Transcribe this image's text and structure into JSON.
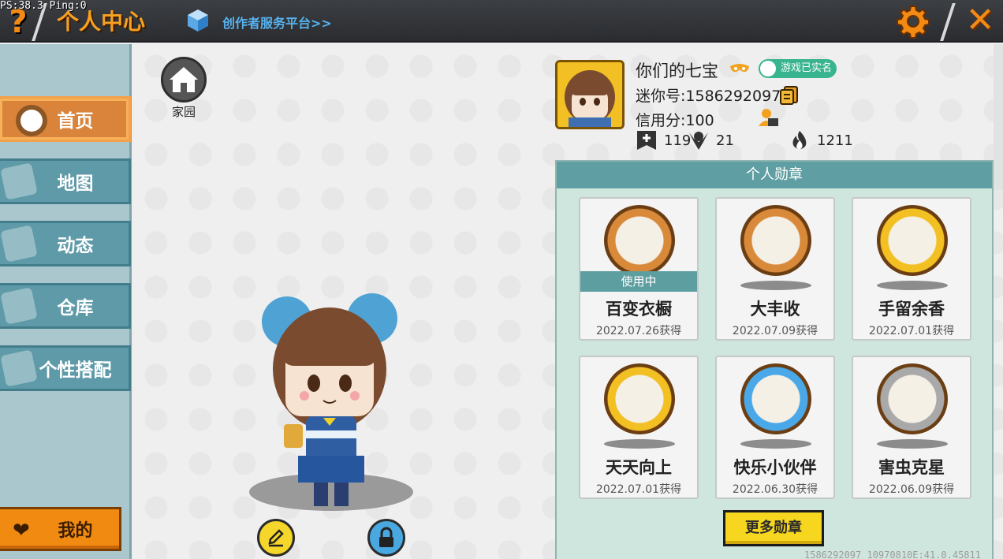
{
  "hud": {
    "fps_text": "PS:38.3  Ping:0"
  },
  "header": {
    "help_glyph": "?",
    "title": "个人中心",
    "creator_link": "创作者服务平台>>",
    "close_glyph": "✕"
  },
  "sidebar": {
    "items": [
      {
        "label": "首页",
        "active": true
      },
      {
        "label": "地图",
        "active": false
      },
      {
        "label": "动态",
        "active": false
      },
      {
        "label": "仓库",
        "active": false
      },
      {
        "label": "个性搭配",
        "active": false
      }
    ],
    "mine_label": "我的"
  },
  "home": {
    "label": "家园"
  },
  "profile": {
    "nickname": "你们的七宝",
    "realname_badge": "游戏已实名",
    "mini_id": "迷你号:1586292097",
    "credit": "信用分:100",
    "stats": [
      {
        "icon": "follow-icon",
        "value": "119"
      },
      {
        "icon": "fans-icon",
        "value": "21"
      },
      {
        "icon": "fire-icon",
        "value": "1211"
      }
    ]
  },
  "badges": {
    "title": "个人勋章",
    "in_use_label": "使用中",
    "items": [
      {
        "name": "百变衣橱",
        "date": "2022.07.26获得",
        "in_use": true,
        "color": "#d88a3a"
      },
      {
        "name": "大丰收",
        "date": "2022.07.09获得",
        "in_use": false,
        "color": "#d88a3a"
      },
      {
        "name": "手留余香",
        "date": "2022.07.01获得",
        "in_use": false,
        "color": "#f2c022"
      },
      {
        "name": "天天向上",
        "date": "2022.07.01获得",
        "in_use": false,
        "color": "#f2c022"
      },
      {
        "name": "快乐小伙伴",
        "date": "2022.06.30获得",
        "in_use": false,
        "color": "#4aa8e8"
      },
      {
        "name": "害虫克星",
        "date": "2022.06.09获得",
        "in_use": false,
        "color": "#a9a9a9"
      }
    ],
    "more_label": "更多勋章"
  },
  "footer": {
    "text": "1586292097   10970810E:41.0.45811"
  },
  "colors": {
    "accent_orange": "#f28a14",
    "sidebar_teal": "#5f9aa8",
    "panel_header": "#5f9ea2",
    "more_button": "#f7d61f"
  }
}
